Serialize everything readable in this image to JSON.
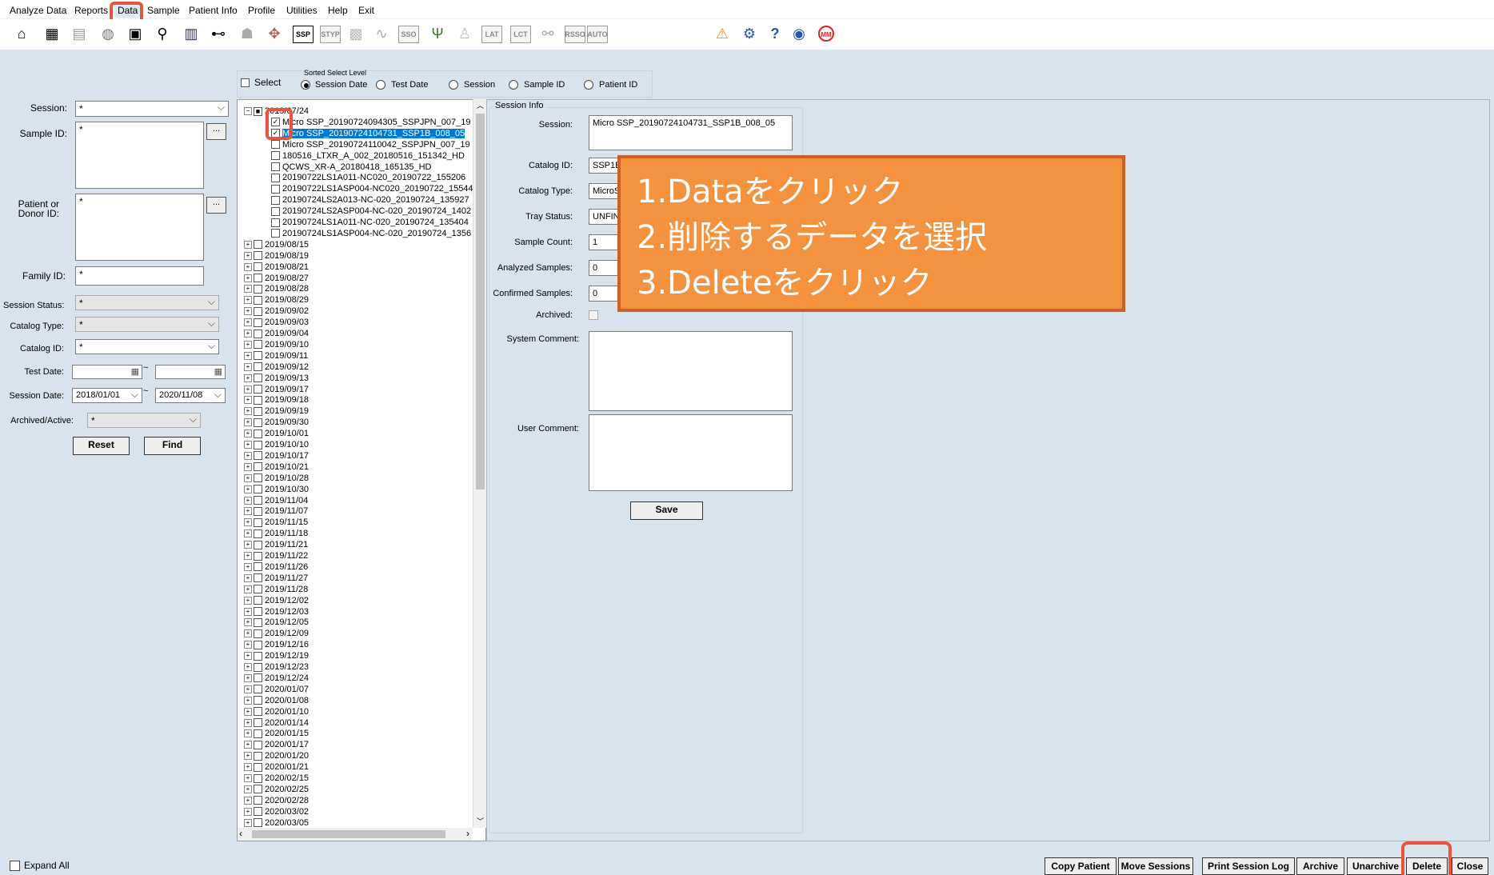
{
  "menu": [
    "Analyze Data",
    "Reports",
    "Data",
    "Sample",
    "Patient Info",
    "Profile",
    "Utilities",
    "Help",
    "Exit"
  ],
  "toolbar": {
    "box_labels": [
      "SSP",
      "STYP",
      "SSO",
      "LAT",
      "LCT",
      "RSSO",
      "AUTO"
    ],
    "mm_label": "MM"
  },
  "sort": {
    "select_label": "Select",
    "group_label": "Sorted Select Level",
    "options": [
      "Session Date",
      "Test Date",
      "Session",
      "Sample ID",
      "Patient ID"
    ]
  },
  "search": {
    "session_label": "Session:",
    "session_value": "*",
    "sample_id_label": "Sample ID:",
    "sample_id_value": "*",
    "patient_label_1": "Patient or",
    "patient_label_2": "Donor ID:",
    "patient_value": "*",
    "family_label": "Family ID:",
    "family_value": "*",
    "session_status_label": "Session Status:",
    "session_status_value": "*",
    "catalog_type_label": "Catalog Type:",
    "catalog_type_value": "*",
    "catalog_id_label": "Catalog ID:",
    "catalog_id_value": "*",
    "test_date_label": "Test Date:",
    "session_date_label": "Session Date:",
    "session_date_from": "2018/01/01",
    "session_date_to": "2020/11/08",
    "archived_label": "Archived/Active:",
    "archived_value": "*",
    "browse_label": "...",
    "reset_label": "Reset",
    "find_label": "Find",
    "range_sep": "~"
  },
  "tree": {
    "root_date": "2019/07/24",
    "children": [
      "Micro SSP_20190724094305_SSPJPN_007_19",
      "Micro SSP_20190724104731_SSP1B_008_05",
      "Micro SSP_20190724110042_SSPJPN_007_19",
      "180516_LTXR_A_002_20180516_151342_HD",
      "QCWS_XR-A_20180418_165135_HD",
      "20190722LS1A011-NC020_20190722_155206",
      "20190722LS1ASP004-NC020_20190722_15544",
      "20190724LS2A013-NC-020_20190724_135927",
      "20190724LS2ASP004-NC-020_20190724_1402",
      "20190724LS1A011-NC-020_20190724_135404",
      "20190724LS1ASP004-NC-020_20190724_1356"
    ],
    "dates": [
      "2019/08/15",
      "2019/08/19",
      "2019/08/21",
      "2019/08/27",
      "2019/08/28",
      "2019/08/29",
      "2019/09/02",
      "2019/09/03",
      "2019/09/04",
      "2019/09/10",
      "2019/09/11",
      "2019/09/12",
      "2019/09/13",
      "2019/09/17",
      "2019/09/18",
      "2019/09/19",
      "2019/09/30",
      "2019/10/01",
      "2019/10/10",
      "2019/10/17",
      "2019/10/21",
      "2019/10/28",
      "2019/10/30",
      "2019/11/04",
      "2019/11/07",
      "2019/11/15",
      "2019/11/18",
      "2019/11/21",
      "2019/11/22",
      "2019/11/26",
      "2019/11/27",
      "2019/11/28",
      "2019/12/02",
      "2019/12/03",
      "2019/12/05",
      "2019/12/09",
      "2019/12/16",
      "2019/12/19",
      "2019/12/23",
      "2019/12/24",
      "2020/01/07",
      "2020/01/08",
      "2020/01/10",
      "2020/01/14",
      "2020/01/15",
      "2020/01/17",
      "2020/01/20",
      "2020/01/21",
      "2020/02/15",
      "2020/02/25",
      "2020/02/28",
      "2020/03/02",
      "2020/03/05"
    ]
  },
  "session_info": {
    "title": "Session Info",
    "session_label": "Session:",
    "session_value": "Micro SSP_20190724104731_SSP1B_008_05",
    "catalog_id_label": "Catalog ID:",
    "catalog_id_value": "SSP1B",
    "catalog_type_label": "Catalog Type:",
    "catalog_type_value": "MicroS",
    "tray_status_label": "Tray Status:",
    "tray_status_value": "UNFIN",
    "sample_count_label": "Sample Count:",
    "sample_count_value": "1",
    "analyzed_label": "Analyzed Samples:",
    "analyzed_value": "0",
    "confirmed_label": "Confirmed Samples:",
    "confirmed_value": "0",
    "archived_label": "Archived:",
    "system_comment_label": "System Comment:",
    "user_comment_label": "User Comment:",
    "save_label": "Save"
  },
  "callout": {
    "line1": "1.Dataをクリック",
    "line2": "2.削除するデータを選択",
    "line3": "3.Deleteをクリック"
  },
  "footer": {
    "expand_all": "Expand All",
    "buttons": [
      "Copy Patient",
      "Move Sessions",
      "Print Session Log",
      "Archive",
      "Unarchive",
      "Delete",
      "Close"
    ]
  }
}
